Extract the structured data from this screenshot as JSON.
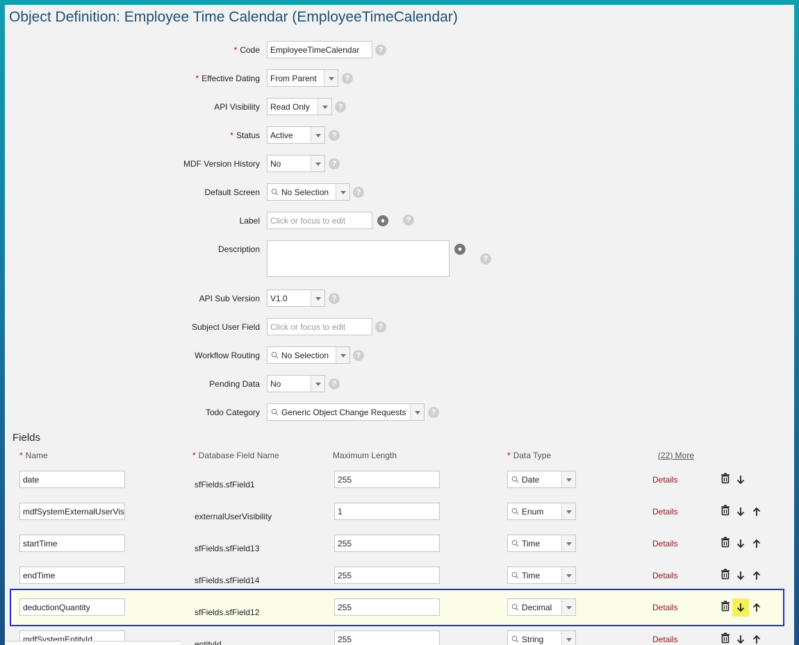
{
  "title": "Object Definition: Employee Time Calendar (EmployeeTimeCalendar)",
  "form": {
    "code": {
      "label": "Code",
      "value": "EmployeeTimeCalendar"
    },
    "effective_dating": {
      "label": "Effective Dating",
      "value": "From Parent"
    },
    "api_visibility": {
      "label": "API Visibility",
      "value": "Read Only"
    },
    "status": {
      "label": "Status",
      "value": "Active"
    },
    "mdf_version_history": {
      "label": "MDF Version History",
      "value": "No"
    },
    "default_screen": {
      "label": "Default Screen",
      "value": "No Selection"
    },
    "label": {
      "label": "Label",
      "placeholder": "Click or focus to edit"
    },
    "description": {
      "label": "Description"
    },
    "api_sub_version": {
      "label": "API Sub Version",
      "value": "V1.0"
    },
    "subject_user_field": {
      "label": "Subject User Field",
      "placeholder": "Click or focus to edit"
    },
    "workflow_routing": {
      "label": "Workflow Routing",
      "value": "No Selection"
    },
    "pending_data": {
      "label": "Pending Data",
      "value": "No"
    },
    "todo_category": {
      "label": "Todo Category",
      "value": "Generic Object Change Requests"
    },
    "required_mark": "*",
    "help_glyph": "?"
  },
  "fields": {
    "heading": "Fields",
    "columns": {
      "name": "Name",
      "db_field": "Database Field Name",
      "max_length": "Maximum Length",
      "data_type": "Data Type",
      "more": "(22) More"
    },
    "details_label": "Details",
    "rows": [
      {
        "name": "date",
        "db": "sfFields.sfField1",
        "max": "255",
        "type": "Date"
      },
      {
        "name": "mdfSystemExternalUserVisibility",
        "db": "externalUserVisibility",
        "max": "1",
        "type": "Enum"
      },
      {
        "name": "startTime",
        "db": "sfFields.sfField13",
        "max": "255",
        "type": "Time"
      },
      {
        "name": "endTime",
        "db": "sfFields.sfField14",
        "max": "255",
        "type": "Time"
      },
      {
        "name": "deductionQuantity",
        "db": "sfFields.sfField12",
        "max": "255",
        "type": "Decimal"
      },
      {
        "name": "mdfSystemEntityId",
        "db": "entityId",
        "max": "255",
        "type": "String"
      }
    ]
  },
  "colors": {
    "title": "#1e4f73",
    "required": "#c0001f",
    "details": "#8b1a1a",
    "highlight_border": "#2b2bd6",
    "highlight_bg": "#fbfde9"
  }
}
